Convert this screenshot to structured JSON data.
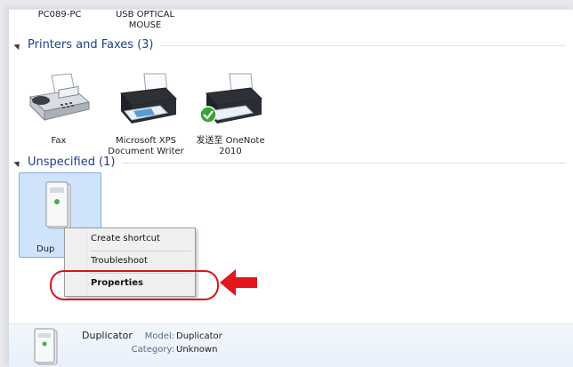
{
  "top_devices": [
    {
      "label": "PC089-PC"
    },
    {
      "label_line1": "USB OPTICAL",
      "label_line2": "MOUSE"
    }
  ],
  "groups": [
    {
      "title": "Printers and Faxes",
      "count": "(3)",
      "devices": [
        {
          "icon": "fax-icon",
          "label_line1": "Fax",
          "label_line2": ""
        },
        {
          "icon": "printer-icon",
          "label_line1": "Microsoft XPS",
          "label_line2": "Document Writer"
        },
        {
          "icon": "default-printer-icon",
          "label_line1": "发送至 OneNote",
          "label_line2": "2010"
        }
      ]
    },
    {
      "title": "Unspecified",
      "count": "(1)",
      "devices": [
        {
          "icon": "server-tower-icon",
          "label_visible": "Dup"
        }
      ]
    }
  ],
  "context_menu": {
    "items": [
      "Create shortcut",
      "Troubleshoot",
      "Properties"
    ],
    "bold_item": "Properties"
  },
  "details": {
    "name": "Duplicator",
    "model_label": "Model:",
    "model_value": "Duplicator",
    "category_label": "Category:",
    "category_value": "Unknown"
  },
  "colors": {
    "group_title": "#1e3f8c",
    "selection_fill": "#cfe3fb",
    "annotation_red": "#d9141b"
  }
}
